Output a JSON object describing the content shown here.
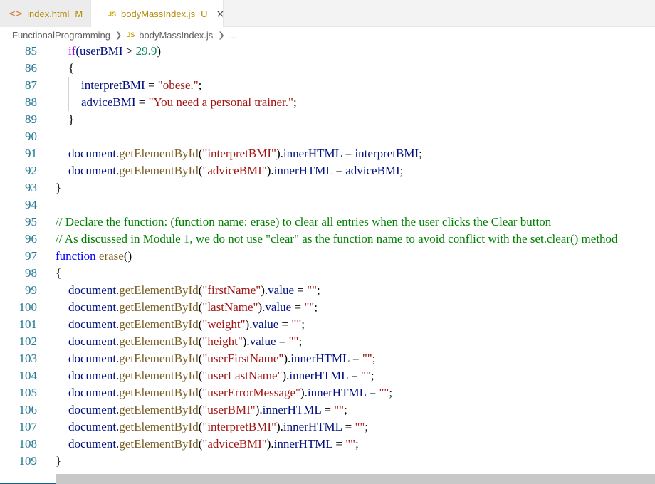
{
  "tabs": [
    {
      "icon": "html-file-icon",
      "icon_text": "<>",
      "label": "index.html",
      "badge": "M"
    },
    {
      "icon": "js-file-icon",
      "icon_text": "JS",
      "label": "bodyMassIndex.js",
      "badge": "U",
      "close": "×"
    }
  ],
  "breadcrumb": {
    "folder": "FunctionalProgramming",
    "icon_text": "JS",
    "file": "bodyMassIndex.js",
    "more": "..."
  },
  "lines": [
    {
      "n": "85",
      "indent": 1,
      "tokens": [
        {
          "t": "if",
          "c": "kw-ctrl"
        },
        {
          "t": "(userBMI "
        },
        {
          "t": ">",
          "c": "pl"
        },
        {
          "t": " "
        },
        {
          "t": "29.9",
          "c": "num"
        },
        {
          "t": ")",
          "c": "pl"
        }
      ]
    },
    {
      "n": "86",
      "indent": 1,
      "tokens": [
        {
          "t": "{",
          "c": "pl"
        }
      ]
    },
    {
      "n": "87",
      "indent": 2,
      "tokens": [
        {
          "t": "interpretBMI "
        },
        {
          "t": "=",
          "c": "pl"
        },
        {
          "t": " "
        },
        {
          "t": "\"obese.\"",
          "c": "str"
        },
        {
          "t": ";",
          "c": "pl"
        }
      ]
    },
    {
      "n": "88",
      "indent": 2,
      "tokens": [
        {
          "t": "adviceBMI "
        },
        {
          "t": "=",
          "c": "pl"
        },
        {
          "t": " "
        },
        {
          "t": "\"You need a personal trainer.\"",
          "c": "str"
        },
        {
          "t": ";",
          "c": "pl"
        }
      ]
    },
    {
      "n": "89",
      "indent": 1,
      "tokens": [
        {
          "t": "}",
          "c": "pl"
        }
      ]
    },
    {
      "n": "90",
      "indent": 1,
      "tokens": []
    },
    {
      "n": "91",
      "indent": 1,
      "tokens": [
        {
          "t": "document."
        },
        {
          "t": "getElementById",
          "c": "fn"
        },
        {
          "t": "(",
          "c": "pl"
        },
        {
          "t": "\"interpretBMI\"",
          "c": "str"
        },
        {
          "t": ").",
          "c": "pl"
        },
        {
          "t": "innerHTML "
        },
        {
          "t": "=",
          "c": "pl"
        },
        {
          "t": " interpretBMI"
        },
        {
          "t": ";",
          "c": "pl"
        }
      ]
    },
    {
      "n": "92",
      "indent": 1,
      "tokens": [
        {
          "t": "document."
        },
        {
          "t": "getElementById",
          "c": "fn"
        },
        {
          "t": "(",
          "c": "pl"
        },
        {
          "t": "\"adviceBMI\"",
          "c": "str"
        },
        {
          "t": ").",
          "c": "pl"
        },
        {
          "t": "innerHTML "
        },
        {
          "t": "=",
          "c": "pl"
        },
        {
          "t": " adviceBMI"
        },
        {
          "t": ";",
          "c": "pl"
        }
      ]
    },
    {
      "n": "93",
      "indent": 0,
      "tokens": [
        {
          "t": "}",
          "c": "pl"
        }
      ]
    },
    {
      "n": "94",
      "indent": 0,
      "tokens": []
    },
    {
      "n": "95",
      "indent": 0,
      "tokens": [
        {
          "t": "// Declare the function: (function name: erase) to clear all entries when the user clicks the Clear button",
          "c": "cm"
        }
      ]
    },
    {
      "n": "96",
      "indent": 0,
      "tokens": [
        {
          "t": "// As discussed in Module 1, we do not use \"clear\" as the function name to avoid conflict with the set.clear() method",
          "c": "cm"
        }
      ]
    },
    {
      "n": "97",
      "indent": 0,
      "tokens": [
        {
          "t": "function",
          "c": "kw"
        },
        {
          "t": " "
        },
        {
          "t": "erase",
          "c": "fn"
        },
        {
          "t": "()",
          "c": "pl"
        }
      ]
    },
    {
      "n": "98",
      "indent": 0,
      "tokens": [
        {
          "t": "{",
          "c": "pl"
        }
      ]
    },
    {
      "n": "99",
      "indent": 1,
      "tokens": [
        {
          "t": "document."
        },
        {
          "t": "getElementById",
          "c": "fn"
        },
        {
          "t": "(",
          "c": "pl"
        },
        {
          "t": "\"firstName\"",
          "c": "str"
        },
        {
          "t": ").",
          "c": "pl"
        },
        {
          "t": "value "
        },
        {
          "t": "=",
          "c": "pl"
        },
        {
          "t": " "
        },
        {
          "t": "\"\"",
          "c": "str"
        },
        {
          "t": ";",
          "c": "pl"
        }
      ]
    },
    {
      "n": "100",
      "indent": 1,
      "tokens": [
        {
          "t": "document."
        },
        {
          "t": "getElementById",
          "c": "fn"
        },
        {
          "t": "(",
          "c": "pl"
        },
        {
          "t": "\"lastName\"",
          "c": "str"
        },
        {
          "t": ").",
          "c": "pl"
        },
        {
          "t": "value "
        },
        {
          "t": "=",
          "c": "pl"
        },
        {
          "t": " "
        },
        {
          "t": "\"\"",
          "c": "str"
        },
        {
          "t": ";",
          "c": "pl"
        }
      ]
    },
    {
      "n": "101",
      "indent": 1,
      "tokens": [
        {
          "t": "document."
        },
        {
          "t": "getElementById",
          "c": "fn"
        },
        {
          "t": "(",
          "c": "pl"
        },
        {
          "t": "\"weight\"",
          "c": "str"
        },
        {
          "t": ").",
          "c": "pl"
        },
        {
          "t": "value "
        },
        {
          "t": "=",
          "c": "pl"
        },
        {
          "t": " "
        },
        {
          "t": "\"\"",
          "c": "str"
        },
        {
          "t": ";",
          "c": "pl"
        }
      ]
    },
    {
      "n": "102",
      "indent": 1,
      "tokens": [
        {
          "t": "document."
        },
        {
          "t": "getElementById",
          "c": "fn"
        },
        {
          "t": "(",
          "c": "pl"
        },
        {
          "t": "\"height\"",
          "c": "str"
        },
        {
          "t": ").",
          "c": "pl"
        },
        {
          "t": "value "
        },
        {
          "t": "=",
          "c": "pl"
        },
        {
          "t": " "
        },
        {
          "t": "\"\"",
          "c": "str"
        },
        {
          "t": ";",
          "c": "pl"
        }
      ]
    },
    {
      "n": "103",
      "indent": 1,
      "tokens": [
        {
          "t": "document."
        },
        {
          "t": "getElementById",
          "c": "fn"
        },
        {
          "t": "(",
          "c": "pl"
        },
        {
          "t": "\"userFirstName\"",
          "c": "str"
        },
        {
          "t": ").",
          "c": "pl"
        },
        {
          "t": "innerHTML "
        },
        {
          "t": "=",
          "c": "pl"
        },
        {
          "t": " "
        },
        {
          "t": "\"\"",
          "c": "str"
        },
        {
          "t": ";",
          "c": "pl"
        }
      ]
    },
    {
      "n": "104",
      "indent": 1,
      "tokens": [
        {
          "t": "document."
        },
        {
          "t": "getElementById",
          "c": "fn"
        },
        {
          "t": "(",
          "c": "pl"
        },
        {
          "t": "\"userLastName\"",
          "c": "str"
        },
        {
          "t": ").",
          "c": "pl"
        },
        {
          "t": "innerHTML "
        },
        {
          "t": "=",
          "c": "pl"
        },
        {
          "t": " "
        },
        {
          "t": "\"\"",
          "c": "str"
        },
        {
          "t": ";",
          "c": "pl"
        }
      ]
    },
    {
      "n": "105",
      "indent": 1,
      "tokens": [
        {
          "t": "document."
        },
        {
          "t": "getElementById",
          "c": "fn"
        },
        {
          "t": "(",
          "c": "pl"
        },
        {
          "t": "\"userErrorMessage\"",
          "c": "str"
        },
        {
          "t": ").",
          "c": "pl"
        },
        {
          "t": "innerHTML "
        },
        {
          "t": "=",
          "c": "pl"
        },
        {
          "t": " "
        },
        {
          "t": "\"\"",
          "c": "str"
        },
        {
          "t": ";",
          "c": "pl"
        }
      ]
    },
    {
      "n": "106",
      "indent": 1,
      "tokens": [
        {
          "t": "document."
        },
        {
          "t": "getElementById",
          "c": "fn"
        },
        {
          "t": "(",
          "c": "pl"
        },
        {
          "t": "\"userBMI\"",
          "c": "str"
        },
        {
          "t": ").",
          "c": "pl"
        },
        {
          "t": "innerHTML "
        },
        {
          "t": "=",
          "c": "pl"
        },
        {
          "t": " "
        },
        {
          "t": "\"\"",
          "c": "str"
        },
        {
          "t": ";",
          "c": "pl"
        }
      ]
    },
    {
      "n": "107",
      "indent": 1,
      "tokens": [
        {
          "t": "document."
        },
        {
          "t": "getElementById",
          "c": "fn"
        },
        {
          "t": "(",
          "c": "pl"
        },
        {
          "t": "\"interpretBMI\"",
          "c": "str"
        },
        {
          "t": ").",
          "c": "pl"
        },
        {
          "t": "innerHTML "
        },
        {
          "t": "=",
          "c": "pl"
        },
        {
          "t": " "
        },
        {
          "t": "\"\"",
          "c": "str"
        },
        {
          "t": ";",
          "c": "pl"
        }
      ]
    },
    {
      "n": "108",
      "indent": 1,
      "tokens": [
        {
          "t": "document."
        },
        {
          "t": "getElementById",
          "c": "fn"
        },
        {
          "t": "(",
          "c": "pl"
        },
        {
          "t": "\"adviceBMI\"",
          "c": "str"
        },
        {
          "t": ").",
          "c": "pl"
        },
        {
          "t": "innerHTML "
        },
        {
          "t": "=",
          "c": "pl"
        },
        {
          "t": " "
        },
        {
          "t": "\"\"",
          "c": "str"
        },
        {
          "t": ";",
          "c": "pl"
        }
      ]
    },
    {
      "n": "109",
      "indent": 0,
      "tokens": [
        {
          "t": "}",
          "c": "pl"
        }
      ]
    }
  ]
}
